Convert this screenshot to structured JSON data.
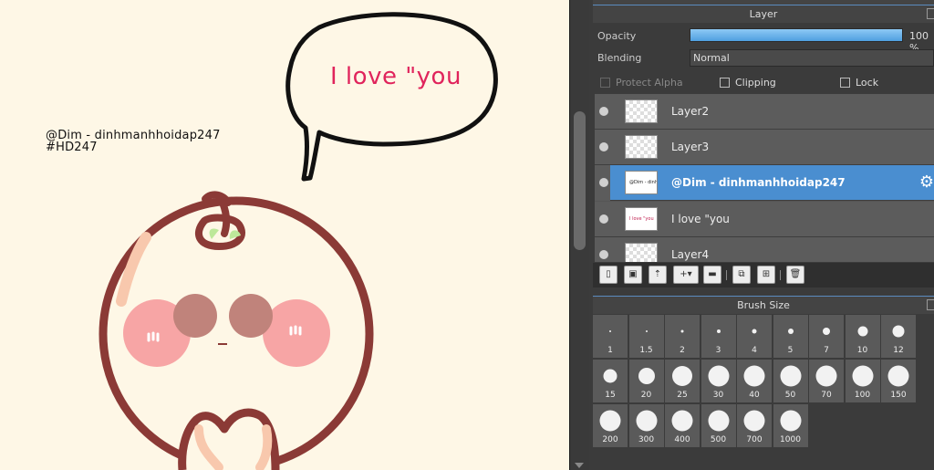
{
  "canvas": {
    "watermark_line1": "@Dim - dinhmanhhoidap247",
    "watermark_line2": "#HD247",
    "bubble_text": "I love \"you"
  },
  "layer_panel": {
    "title": "Layer",
    "opacity_label": "Opacity",
    "opacity_value": "100 %",
    "opacity_fraction": 1.0,
    "blending_label": "Blending",
    "blending_value": "Normal",
    "protect_alpha_label": "Protect Alpha",
    "clipping_label": "Clipping",
    "lock_label": "Lock",
    "layers": [
      {
        "name": "Layer2",
        "thumb_text": "",
        "selected": false
      },
      {
        "name": "Layer3",
        "thumb_text": "",
        "selected": false
      },
      {
        "name": "@Dim - dinhmanhhoidap247",
        "thumb_text": "@Dim - dinhmanhhoidap247",
        "selected": true
      },
      {
        "name": "I love \"you",
        "thumb_text": "I love \"you",
        "selected": false
      },
      {
        "name": "Layer4",
        "thumb_text": "",
        "selected": false
      }
    ]
  },
  "brush_panel": {
    "title": "Brush Size",
    "sizes": [
      "1",
      "1.5",
      "2",
      "3",
      "4",
      "5",
      "7",
      "10",
      "12",
      "15",
      "20",
      "25",
      "30",
      "40",
      "50",
      "70",
      "100",
      "150",
      "200",
      "300",
      "400",
      "500",
      "700",
      "1000"
    ]
  },
  "colors": {
    "canvas_bg": "#fef7e6",
    "outline": "#8b3a36",
    "cheek": "#f7a5a5",
    "eye": "#c0837b",
    "leaf": "#bde89a",
    "bubble_text": "#e0245c",
    "selection": "#4a8ed0",
    "opacity_bar": "#5fb0ea"
  },
  "icons": [
    "new-layer-icon",
    "duplicate-layer-icon",
    "import-layer-icon",
    "add-layer-dropdown-icon",
    "folder-icon",
    "copy-icon",
    "merge-icon",
    "trash-icon",
    "gear-icon",
    "eye-icon"
  ]
}
